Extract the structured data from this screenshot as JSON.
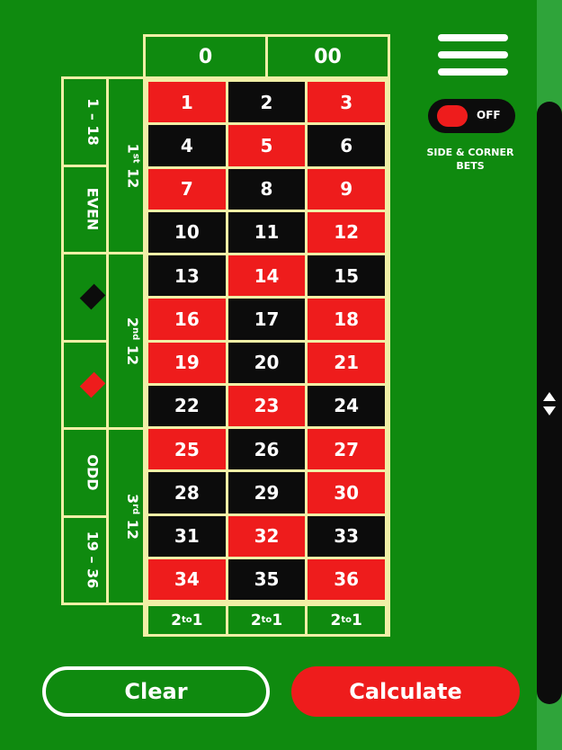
{
  "zeros": [
    "0",
    "00"
  ],
  "numbers": [
    {
      "n": "1",
      "color": "red"
    },
    {
      "n": "2",
      "color": "black"
    },
    {
      "n": "3",
      "color": "red"
    },
    {
      "n": "4",
      "color": "black"
    },
    {
      "n": "5",
      "color": "red"
    },
    {
      "n": "6",
      "color": "black"
    },
    {
      "n": "7",
      "color": "red"
    },
    {
      "n": "8",
      "color": "black"
    },
    {
      "n": "9",
      "color": "red"
    },
    {
      "n": "10",
      "color": "black"
    },
    {
      "n": "11",
      "color": "black"
    },
    {
      "n": "12",
      "color": "red"
    },
    {
      "n": "13",
      "color": "black"
    },
    {
      "n": "14",
      "color": "red"
    },
    {
      "n": "15",
      "color": "black"
    },
    {
      "n": "16",
      "color": "red"
    },
    {
      "n": "17",
      "color": "black"
    },
    {
      "n": "18",
      "color": "red"
    },
    {
      "n": "19",
      "color": "red"
    },
    {
      "n": "20",
      "color": "black"
    },
    {
      "n": "21",
      "color": "red"
    },
    {
      "n": "22",
      "color": "black"
    },
    {
      "n": "23",
      "color": "red"
    },
    {
      "n": "24",
      "color": "black"
    },
    {
      "n": "25",
      "color": "red"
    },
    {
      "n": "26",
      "color": "black"
    },
    {
      "n": "27",
      "color": "red"
    },
    {
      "n": "28",
      "color": "black"
    },
    {
      "n": "29",
      "color": "black"
    },
    {
      "n": "30",
      "color": "red"
    },
    {
      "n": "31",
      "color": "black"
    },
    {
      "n": "32",
      "color": "red"
    },
    {
      "n": "33",
      "color": "black"
    },
    {
      "n": "34",
      "color": "red"
    },
    {
      "n": "35",
      "color": "black"
    },
    {
      "n": "36",
      "color": "red"
    }
  ],
  "columns": [
    {
      "main": "2",
      "sup": "to",
      "end": "1"
    },
    {
      "main": "2",
      "sup": "to",
      "end": "1"
    },
    {
      "main": "2",
      "sup": "to",
      "end": "1"
    }
  ],
  "dozens": [
    {
      "main": "1",
      "sup": "st",
      "end": " 12"
    },
    {
      "main": "2",
      "sup": "nd",
      "end": " 12"
    },
    {
      "main": "3",
      "sup": "rd",
      "end": " 12"
    }
  ],
  "outside": {
    "low": "1 – 18",
    "even": "EVEN",
    "black_icon": "black-diamond-icon",
    "red_icon": "red-diamond-icon",
    "odd": "ODD",
    "high": "19 – 36"
  },
  "toggle": {
    "state": "OFF",
    "label": "SIDE & CORNER BETS"
  },
  "buttons": {
    "clear": "Clear",
    "calculate": "Calculate"
  },
  "colors": {
    "felt": "#0f8a0f",
    "red": "#ee1c1c",
    "black": "#0c0c0c",
    "line": "#f1efa6"
  }
}
